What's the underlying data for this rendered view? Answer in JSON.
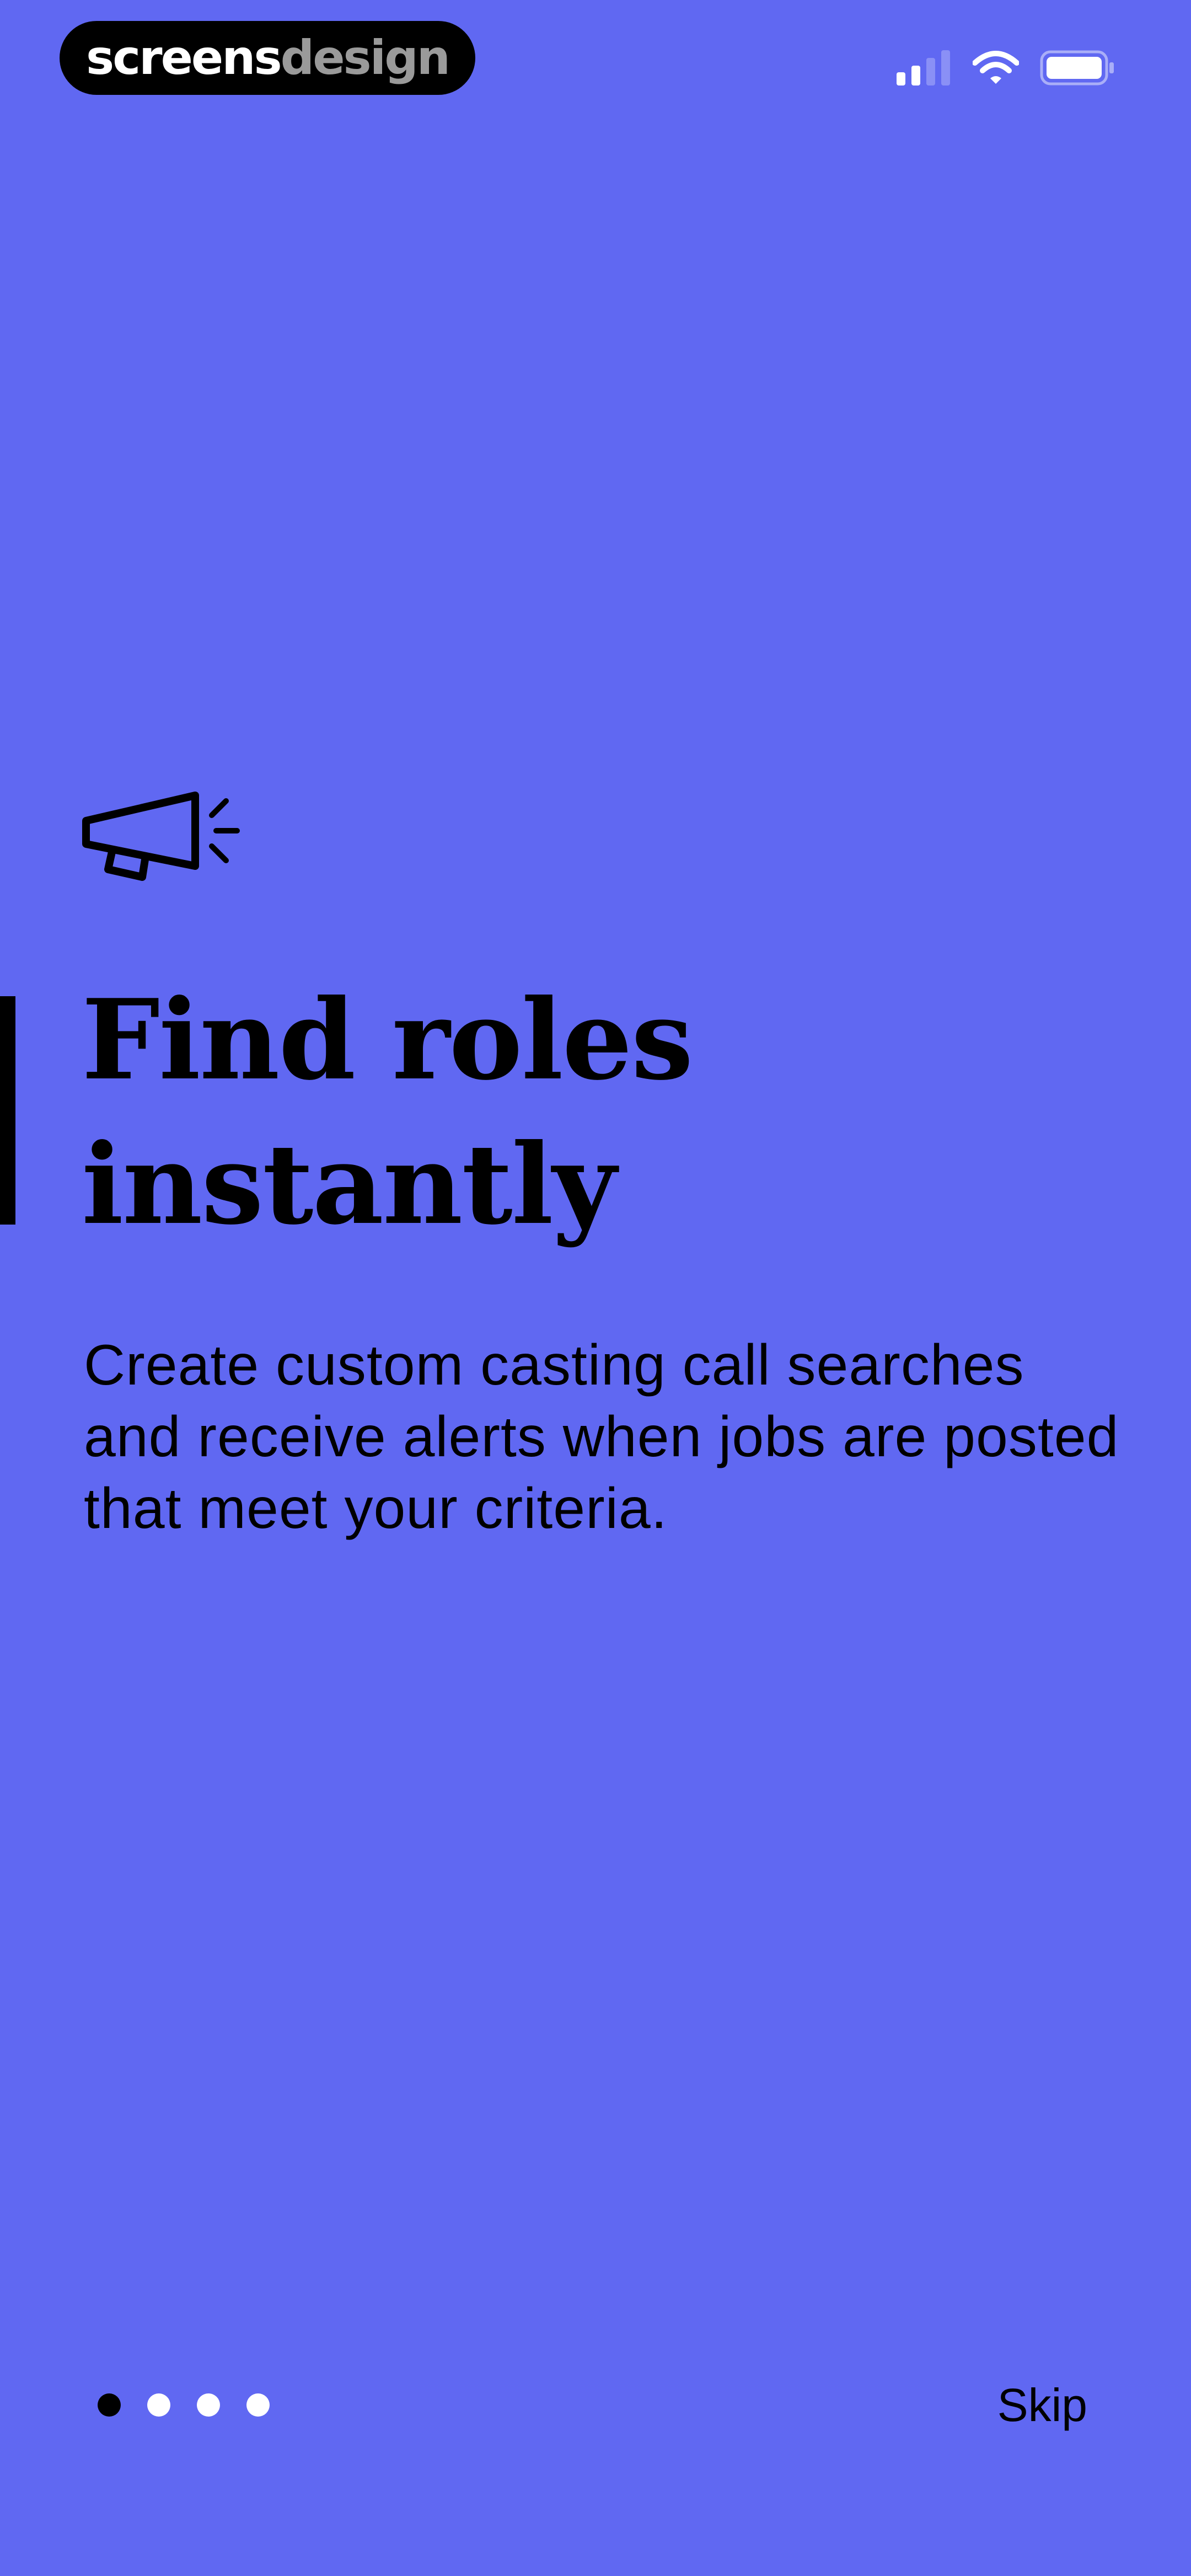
{
  "watermark": {
    "part1": "screens",
    "part2": "design"
  },
  "status_bar": {
    "signal_icon": "cellular-signal-icon",
    "wifi_icon": "wifi-icon",
    "battery_icon": "battery-icon"
  },
  "onboarding": {
    "icon": "megaphone-icon",
    "title_line1": "Find roles",
    "title_line2": "instantly",
    "body": "Create custom casting call searches and receive alerts when jobs are posted that meet your criteria."
  },
  "pager": {
    "total": 4,
    "current": 1
  },
  "skip_label": "Skip",
  "colors": {
    "background": "#6068F2",
    "text": "#000000",
    "dot_inactive": "#FFFFFF",
    "dot_active": "#000000"
  }
}
